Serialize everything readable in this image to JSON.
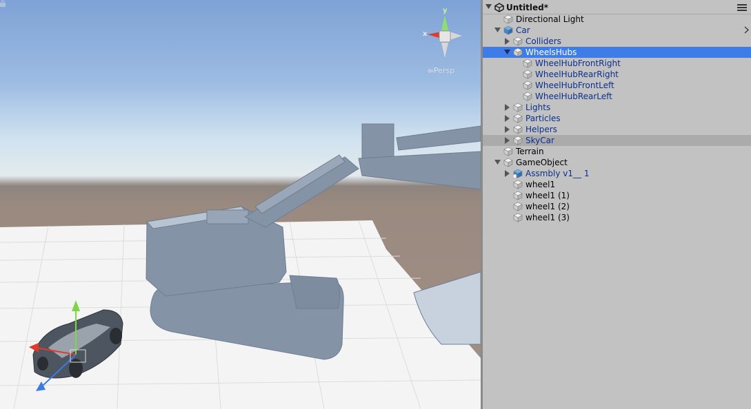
{
  "scene_view": {
    "persp_label": "Persp",
    "axis_x": "x",
    "axis_y": "y"
  },
  "hierarchy": {
    "scene_name": "Untitled*",
    "items": [
      {
        "label": "Directional Light",
        "depth": 0,
        "fold": "none",
        "style": "black"
      },
      {
        "label": "Car",
        "depth": 0,
        "fold": "open",
        "style": "blue",
        "icon": "prefab"
      },
      {
        "label": "Colliders",
        "depth": 1,
        "fold": "closed",
        "style": "blue"
      },
      {
        "label": "WheelsHubs",
        "depth": 1,
        "fold": "open",
        "style": "white",
        "selected": true
      },
      {
        "label": "WheelHubFrontRight",
        "depth": 2,
        "fold": "none",
        "style": "blue"
      },
      {
        "label": "WheelHubRearRight",
        "depth": 2,
        "fold": "none",
        "style": "blue"
      },
      {
        "label": "WheelHubFrontLeft",
        "depth": 2,
        "fold": "none",
        "style": "blue"
      },
      {
        "label": "WheelHubRearLeft",
        "depth": 2,
        "fold": "none",
        "style": "blue"
      },
      {
        "label": "Lights",
        "depth": 1,
        "fold": "closed",
        "style": "blue"
      },
      {
        "label": "Particles",
        "depth": 1,
        "fold": "closed",
        "style": "blue"
      },
      {
        "label": "Helpers",
        "depth": 1,
        "fold": "closed",
        "style": "blue"
      },
      {
        "label": "SkyCar",
        "depth": 1,
        "fold": "closed",
        "style": "blue",
        "hover": true
      },
      {
        "label": "Terrain",
        "depth": 0,
        "fold": "none",
        "style": "black"
      },
      {
        "label": "GameObject",
        "depth": 0,
        "fold": "open",
        "style": "black"
      },
      {
        "label": "Assmbly v1__ 1",
        "depth": 1,
        "fold": "closed",
        "style": "blue",
        "icon": "prefab-model"
      },
      {
        "label": "wheel1",
        "depth": 1,
        "fold": "none",
        "style": "black"
      },
      {
        "label": "wheel1 (1)",
        "depth": 1,
        "fold": "none",
        "style": "black"
      },
      {
        "label": "wheel1 (2)",
        "depth": 1,
        "fold": "none",
        "style": "black"
      },
      {
        "label": "wheel1 (3)",
        "depth": 1,
        "fold": "none",
        "style": "black"
      }
    ]
  },
  "colors": {
    "selection": "#3e7de7",
    "prefab_text": "#0a2f8c",
    "panel_bg": "#c2c2c2"
  }
}
